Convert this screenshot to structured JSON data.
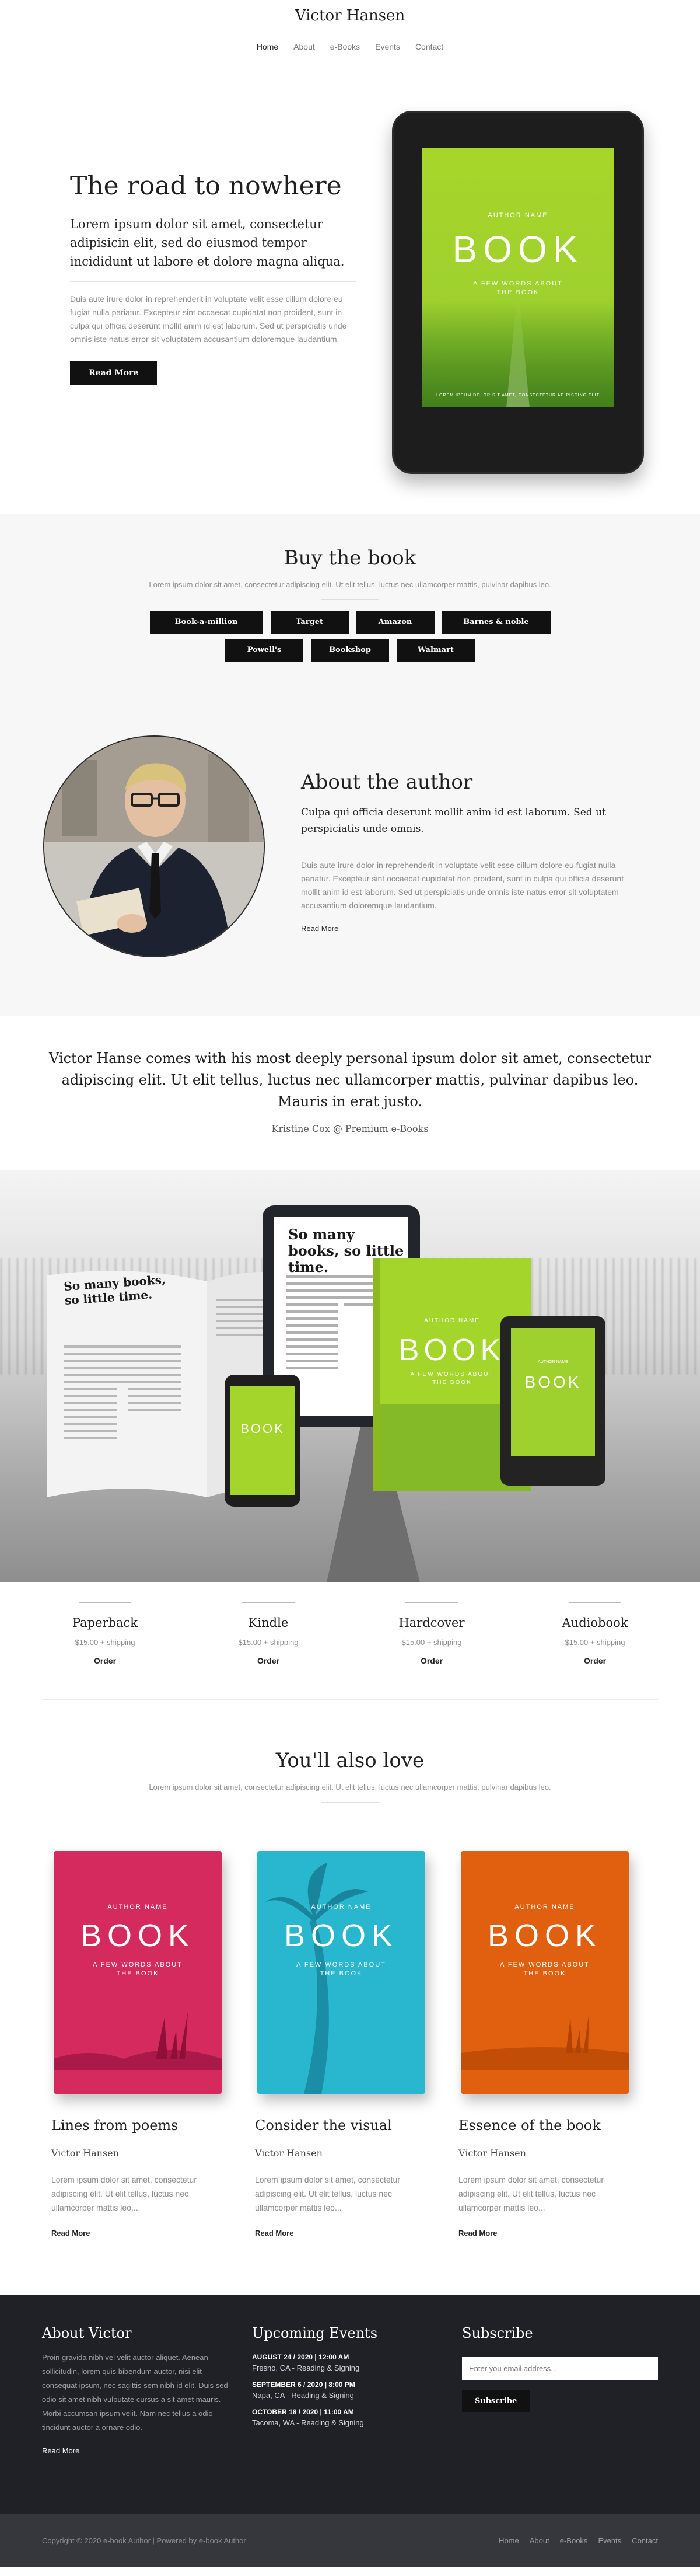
{
  "site": {
    "title": "Victor Hansen"
  },
  "nav": [
    "Home",
    "About",
    "e-Books",
    "Events",
    "Contact"
  ],
  "hero": {
    "title": "The road to nowhere",
    "lead": "Lorem ipsum dolor sit amet, consectetur adipisicin elit, sed do eiusmod tempor incididunt ut labore et dolore magna aliqua.",
    "body": "Duis aute irure dolor in reprehenderit in voluptate velit esse cillum dolore eu fugiat nulla pariatur. Excepteur sint occaecat cupidatat non proident, sunt in culpa qui officia deserunt mollit anim id est laborum. Sed ut perspiciatis unde omnis iste natus error sit voluptatem accusantium doloremque laudantium.",
    "button": "Read More"
  },
  "cover": {
    "author": "AUTHOR NAME",
    "book": "BOOK",
    "sub1": "A FEW WORDS ABOUT",
    "sub2": "THE BOOK",
    "foot": "LOREM IPSUM DOLOR SIT AMET, CONSECTETUR ADIPISCING ELIT"
  },
  "buy": {
    "title": "Buy the book",
    "subtitle": "Lorem ipsum dolor sit amet, consectetur adipiscing elit. Ut elit tellus, luctus nec ullamcorper mattis, pulvinar dapibus leo.",
    "stores_row1": [
      "Book-a-million",
      "Target",
      "Amazon",
      "Barnes & noble"
    ],
    "stores_row2": [
      "Powell's",
      "Bookshop",
      "Walmart"
    ]
  },
  "author": {
    "title": "About the author",
    "lead": "Culpa qui officia deserunt mollit anim id est laborum. Sed ut perspiciatis unde omnis.",
    "body": "Duis aute irure dolor in reprehenderit in voluptate velit esse cillum dolore eu fugiat nulla pariatur. Excepteur sint occaecat cupidatat non proident, sunt in culpa qui officia deserunt mollit anim id est laborum. Sed ut perspiciatis unde omnis iste natus error sit voluptatem accusantium doloremque laudantium.",
    "link": "Read More"
  },
  "quote": {
    "text": "Victor Hanse comes with his most deeply personal ipsum dolor sit amet, consectetur adipiscing elit. Ut elit tellus, luctus nec ullamcorper mattis, pulvinar dapibus leo. Mauris in erat justo.",
    "by": "Kristine Cox @ Premium e-Books"
  },
  "mockup": {
    "heading": "So many books, so little time."
  },
  "formats": [
    {
      "name": "Paperback",
      "price": "$15.00 + shipping",
      "order": "Order"
    },
    {
      "name": "Kindle",
      "price": "$15.00 + shipping",
      "order": "Order"
    },
    {
      "name": "Hardcover",
      "price": "$15.00 + shipping",
      "order": "Order"
    },
    {
      "name": "Audiobook",
      "price": "$15.00 + shipping",
      "order": "Order"
    }
  ],
  "also": {
    "title": "You'll also love",
    "subtitle": "Lorem ipsum dolor sit amet, consectetur adipiscing elit. Ut elit tellus, luctus nec ullamcorper mattis, pulvinar dapibus leo.",
    "books": [
      {
        "title": "Lines from poems",
        "author": "Victor Hansen",
        "desc": "Lorem ipsum dolor sit amet, consectetur adipiscing elit. Ut elit tellus, luctus nec ullamcorper mattis leo...",
        "link": "Read More",
        "color": "#d42a5e"
      },
      {
        "title": "Consider the visual",
        "author": "Victor Hansen",
        "desc": "Lorem ipsum dolor sit amet, consectetur adipiscing elit. Ut elit tellus, luctus nec ullamcorper mattis leo...",
        "link": "Read More",
        "color": "#29b6cf"
      },
      {
        "title": "Essence of the book",
        "author": "Victor Hansen",
        "desc": "Lorem ipsum dolor sit amet, consectetur adipiscing elit. Ut elit tellus, luctus nec ullamcorper mattis leo...",
        "link": "Read More",
        "color": "#e0600f"
      }
    ]
  },
  "footer": {
    "about_title": "About Victor",
    "about_text": "Proin gravida nibh vel velit auctor aliquet. Aenean sollicitudin, lorem quis bibendum auctor, nisi elit consequat ipsum, nec sagittis sem nibh id elit. Duis sed odio sit amet nibh vulputate cursus a sit amet mauris. Morbi accumsan ipsum velit. Nam nec tellus a odio tincidunt auctor a ornare odio.",
    "about_link": "Read More",
    "events_title": "Upcoming Events",
    "events": [
      {
        "date": "AUGUST 24 / 2020 | 12:00 AM",
        "location": "Fresno, CA - Reading & Signing"
      },
      {
        "date": "SEPTEMBER 6 / 2020 | 8:00 PM",
        "location": "Napa, CA - Reading & Signing"
      },
      {
        "date": "OCTOBER 18 / 2020 | 11:00 AM",
        "location": "Tacoma, WA - Reading & Signing"
      }
    ],
    "subscribe_title": "Subscribe",
    "email_placeholder": "Enter you email address...",
    "subscribe_button": "Subscribe",
    "copyright": "Copyright © 2020 e-book Author | Powered by e-book Author",
    "nav": [
      "Home",
      "About",
      "e-Books",
      "Events",
      "Contact"
    ]
  },
  "colors": {
    "accent_green": "#a6d62b",
    "footer_bg": "#1f2126",
    "button_bg": "#111111"
  }
}
